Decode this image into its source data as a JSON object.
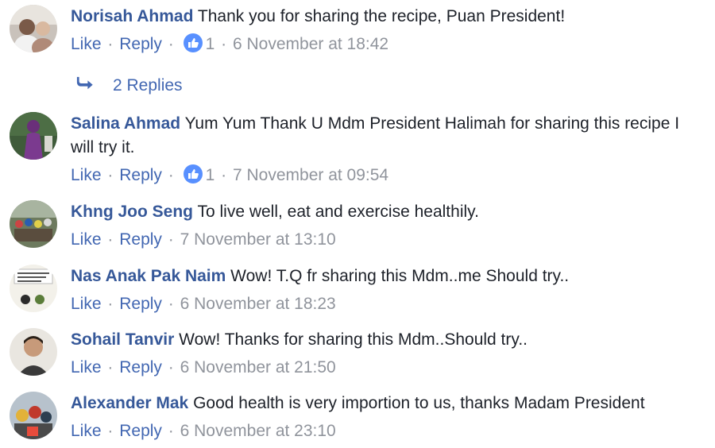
{
  "actions": {
    "like": "Like",
    "reply": "Reply",
    "separator": "·"
  },
  "colors": {
    "name": "#365899",
    "link": "#4267b2",
    "meta": "#90949c",
    "like_badge": "#5890ff"
  },
  "comments": [
    {
      "author": "Norisah Ahmad",
      "text": "Thank you for sharing the recipe, Puan President!",
      "like_count": "1",
      "timestamp": "6 November at 18:42",
      "replies_label": "2 Replies"
    },
    {
      "author": "Salina Ahmad",
      "text": "Yum Yum Thank U Mdm President Halimah for sharing this recipe I will try it.",
      "like_count": "1",
      "timestamp": "7 November at 09:54"
    },
    {
      "author": "Khng Joo Seng",
      "text": "To live well, eat and exercise healthily.",
      "timestamp": "7 November at 13:10"
    },
    {
      "author": "Nas Anak Pak Naim",
      "text": "Wow! T.Q fr sharing this Mdm..me Should try..",
      "timestamp": "6 November at 18:23"
    },
    {
      "author": "Sohail Tanvir",
      "text": "Wow! Thanks for sharing this Mdm..Should try..",
      "timestamp": "6 November at 21:50"
    },
    {
      "author": "Alexander Mak",
      "text": "Good health is very importion to us, thanks Madam President",
      "timestamp": "6 November at 23:10"
    }
  ]
}
